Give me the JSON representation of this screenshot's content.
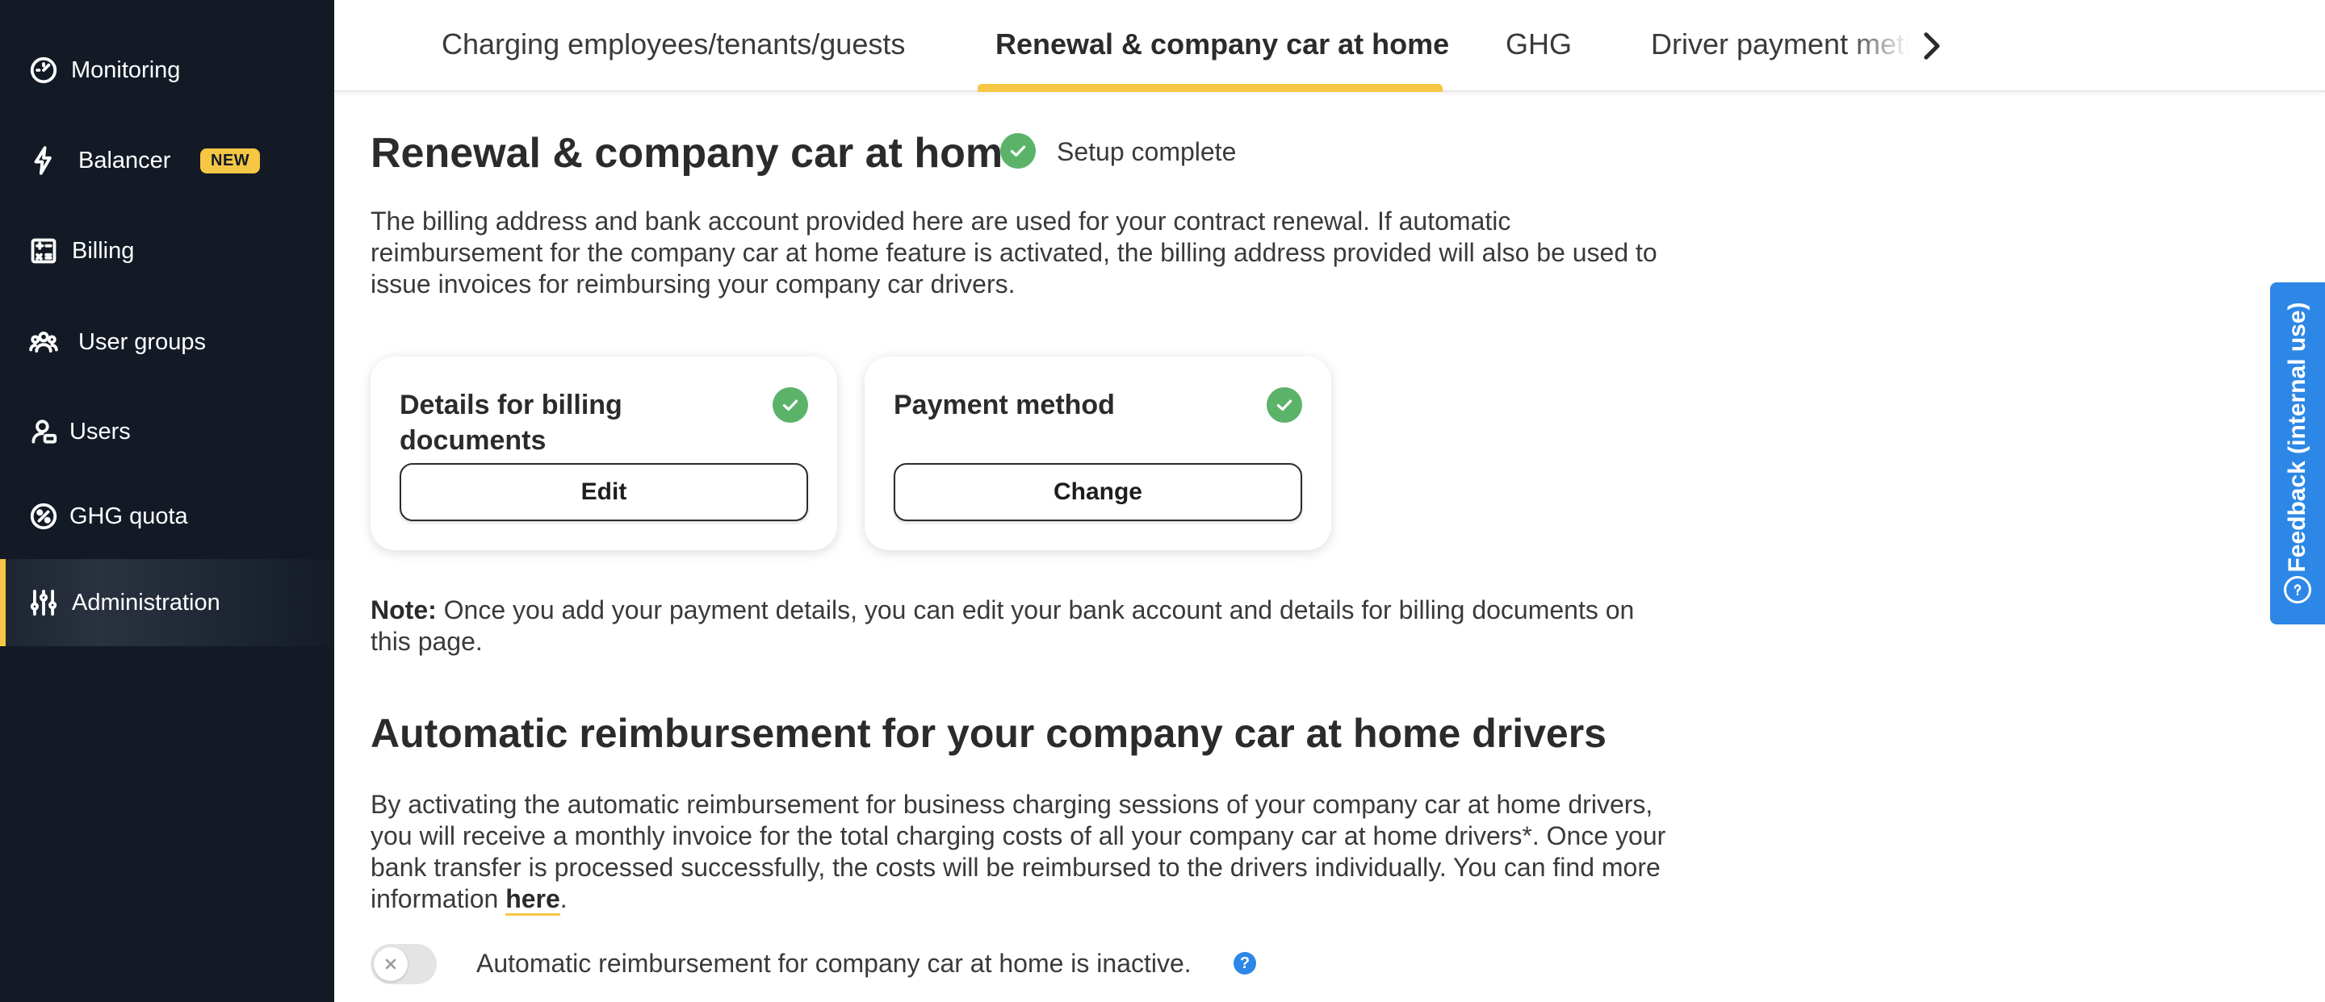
{
  "sidebar": {
    "items": [
      {
        "label": "Monitoring",
        "icon": "speedometer-icon"
      },
      {
        "label": "Balancer",
        "icon": "lightning-icon",
        "badge": "NEW"
      },
      {
        "label": "Billing",
        "icon": "calculator-icon"
      },
      {
        "label": "User groups",
        "icon": "user-group-icon"
      },
      {
        "label": "Users",
        "icon": "user-icon"
      },
      {
        "label": "GHG quota",
        "icon": "percent-badge-icon"
      },
      {
        "label": "Administration",
        "icon": "sliders-icon",
        "active": true
      }
    ]
  },
  "tabs": [
    {
      "label": "Charging employees/tenants/guests"
    },
    {
      "label": "Renewal & company car at home",
      "active": true
    },
    {
      "label": "GHG"
    },
    {
      "label": "Driver payment methods"
    }
  ],
  "main": {
    "title": "Renewal & company car at home",
    "status": "Setup complete",
    "intro": "The billing address and bank account provided here are used for your contract renewal. If automatic reimbursement for the company car at home feature is activated, the billing address provided will also be used to issue invoices for reimbursing your company car drivers.",
    "cards": [
      {
        "title": "Details for billing documents",
        "button": "Edit"
      },
      {
        "title": "Payment method",
        "button": "Change"
      }
    ],
    "note_label": "Note:",
    "note_text": " Once you add your payment details, you can edit your bank account and details for billing documents on this page.",
    "section_title": "Automatic reimbursement for your company car at home drivers",
    "section_text": "By activating the automatic reimbursement for business charging sessions of your company car at home drivers, you will receive a monthly invoice for the total charging costs of all your company car at home drivers*. Once your bank transfer is processed successfully, the costs will be reimbursed to the drivers individually. You can find more information ",
    "section_link": "here",
    "section_end": ".",
    "toggle_label": "Automatic reimbursement for company car at home is inactive.",
    "toggle_on": false,
    "help": "?"
  },
  "feedback": {
    "label": "Feedback (internal use)"
  },
  "colors": {
    "accent": "#f6c744",
    "sidebar": "#131a26",
    "success": "#5bb36a",
    "info": "#2d87e6"
  }
}
